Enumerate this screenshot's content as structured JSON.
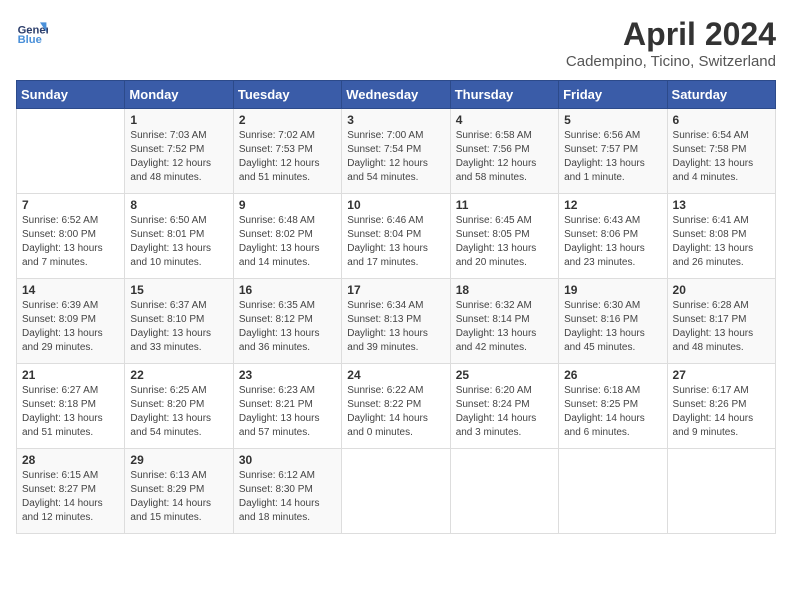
{
  "header": {
    "logo_line1": "General",
    "logo_line2": "Blue",
    "month": "April 2024",
    "location": "Cadempino, Ticino, Switzerland"
  },
  "days_of_week": [
    "Sunday",
    "Monday",
    "Tuesday",
    "Wednesday",
    "Thursday",
    "Friday",
    "Saturday"
  ],
  "weeks": [
    [
      {
        "day": "",
        "info": ""
      },
      {
        "day": "1",
        "info": "Sunrise: 7:03 AM\nSunset: 7:52 PM\nDaylight: 12 hours\nand 48 minutes."
      },
      {
        "day": "2",
        "info": "Sunrise: 7:02 AM\nSunset: 7:53 PM\nDaylight: 12 hours\nand 51 minutes."
      },
      {
        "day": "3",
        "info": "Sunrise: 7:00 AM\nSunset: 7:54 PM\nDaylight: 12 hours\nand 54 minutes."
      },
      {
        "day": "4",
        "info": "Sunrise: 6:58 AM\nSunset: 7:56 PM\nDaylight: 12 hours\nand 58 minutes."
      },
      {
        "day": "5",
        "info": "Sunrise: 6:56 AM\nSunset: 7:57 PM\nDaylight: 13 hours\nand 1 minute."
      },
      {
        "day": "6",
        "info": "Sunrise: 6:54 AM\nSunset: 7:58 PM\nDaylight: 13 hours\nand 4 minutes."
      }
    ],
    [
      {
        "day": "7",
        "info": "Sunrise: 6:52 AM\nSunset: 8:00 PM\nDaylight: 13 hours\nand 7 minutes."
      },
      {
        "day": "8",
        "info": "Sunrise: 6:50 AM\nSunset: 8:01 PM\nDaylight: 13 hours\nand 10 minutes."
      },
      {
        "day": "9",
        "info": "Sunrise: 6:48 AM\nSunset: 8:02 PM\nDaylight: 13 hours\nand 14 minutes."
      },
      {
        "day": "10",
        "info": "Sunrise: 6:46 AM\nSunset: 8:04 PM\nDaylight: 13 hours\nand 17 minutes."
      },
      {
        "day": "11",
        "info": "Sunrise: 6:45 AM\nSunset: 8:05 PM\nDaylight: 13 hours\nand 20 minutes."
      },
      {
        "day": "12",
        "info": "Sunrise: 6:43 AM\nSunset: 8:06 PM\nDaylight: 13 hours\nand 23 minutes."
      },
      {
        "day": "13",
        "info": "Sunrise: 6:41 AM\nSunset: 8:08 PM\nDaylight: 13 hours\nand 26 minutes."
      }
    ],
    [
      {
        "day": "14",
        "info": "Sunrise: 6:39 AM\nSunset: 8:09 PM\nDaylight: 13 hours\nand 29 minutes."
      },
      {
        "day": "15",
        "info": "Sunrise: 6:37 AM\nSunset: 8:10 PM\nDaylight: 13 hours\nand 33 minutes."
      },
      {
        "day": "16",
        "info": "Sunrise: 6:35 AM\nSunset: 8:12 PM\nDaylight: 13 hours\nand 36 minutes."
      },
      {
        "day": "17",
        "info": "Sunrise: 6:34 AM\nSunset: 8:13 PM\nDaylight: 13 hours\nand 39 minutes."
      },
      {
        "day": "18",
        "info": "Sunrise: 6:32 AM\nSunset: 8:14 PM\nDaylight: 13 hours\nand 42 minutes."
      },
      {
        "day": "19",
        "info": "Sunrise: 6:30 AM\nSunset: 8:16 PM\nDaylight: 13 hours\nand 45 minutes."
      },
      {
        "day": "20",
        "info": "Sunrise: 6:28 AM\nSunset: 8:17 PM\nDaylight: 13 hours\nand 48 minutes."
      }
    ],
    [
      {
        "day": "21",
        "info": "Sunrise: 6:27 AM\nSunset: 8:18 PM\nDaylight: 13 hours\nand 51 minutes."
      },
      {
        "day": "22",
        "info": "Sunrise: 6:25 AM\nSunset: 8:20 PM\nDaylight: 13 hours\nand 54 minutes."
      },
      {
        "day": "23",
        "info": "Sunrise: 6:23 AM\nSunset: 8:21 PM\nDaylight: 13 hours\nand 57 minutes."
      },
      {
        "day": "24",
        "info": "Sunrise: 6:22 AM\nSunset: 8:22 PM\nDaylight: 14 hours\nand 0 minutes."
      },
      {
        "day": "25",
        "info": "Sunrise: 6:20 AM\nSunset: 8:24 PM\nDaylight: 14 hours\nand 3 minutes."
      },
      {
        "day": "26",
        "info": "Sunrise: 6:18 AM\nSunset: 8:25 PM\nDaylight: 14 hours\nand 6 minutes."
      },
      {
        "day": "27",
        "info": "Sunrise: 6:17 AM\nSunset: 8:26 PM\nDaylight: 14 hours\nand 9 minutes."
      }
    ],
    [
      {
        "day": "28",
        "info": "Sunrise: 6:15 AM\nSunset: 8:27 PM\nDaylight: 14 hours\nand 12 minutes."
      },
      {
        "day": "29",
        "info": "Sunrise: 6:13 AM\nSunset: 8:29 PM\nDaylight: 14 hours\nand 15 minutes."
      },
      {
        "day": "30",
        "info": "Sunrise: 6:12 AM\nSunset: 8:30 PM\nDaylight: 14 hours\nand 18 minutes."
      },
      {
        "day": "",
        "info": ""
      },
      {
        "day": "",
        "info": ""
      },
      {
        "day": "",
        "info": ""
      },
      {
        "day": "",
        "info": ""
      }
    ]
  ]
}
